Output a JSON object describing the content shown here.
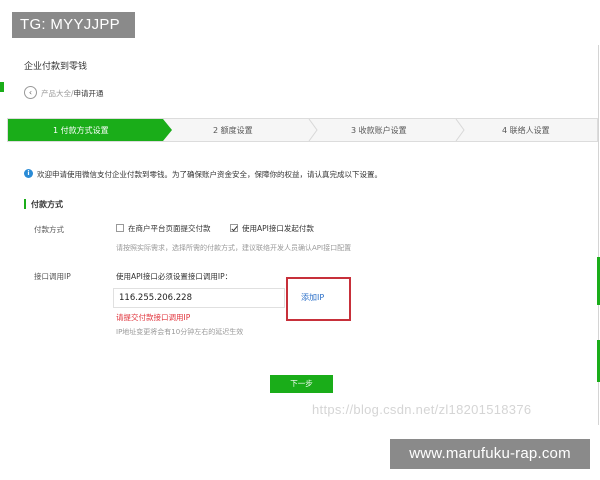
{
  "overlay": {
    "tg_badge": "TG: MYYJJPP",
    "footer_banner": "www.marufuku-rap.com",
    "watermark": "https://blog.csdn.net/zl18201518376"
  },
  "colors": {
    "accent_green": "#1aad19",
    "link_blue": "#2a6fc8",
    "error_red": "#e0323a",
    "highlight_box": "#c7303a"
  },
  "page": {
    "title": "企业付款到零钱"
  },
  "breadcrumb": {
    "icon": "back-arrow-icon",
    "parent": "产品大全",
    "separator": "/",
    "current": "申请开通"
  },
  "steps": [
    {
      "label": "1 付款方式设置",
      "active": true
    },
    {
      "label": "2 额度设置",
      "active": false
    },
    {
      "label": "3 收款账户设置",
      "active": false
    },
    {
      "label": "4 联络人设置",
      "active": false
    }
  ],
  "notice": {
    "icon": "info-icon",
    "text": "欢迎申请使用微信支付企业付款到零钱。为了确保账户资金安全，保障你的权益，请认真完成以下设置。"
  },
  "section": {
    "title": "付款方式"
  },
  "payment_method": {
    "label": "付款方式",
    "options": [
      {
        "label": "在商户平台页面提交付款",
        "checked": false
      },
      {
        "label": "使用API接口发起付款",
        "checked": true
      }
    ],
    "hint": "请按照实际需求，选择所需的付款方式，建议联络开发人员确认API接口配置"
  },
  "api_ip": {
    "label": "接口调用IP",
    "requirement": "使用API接口必须设置接口调用IP：",
    "value": "116.255.206.228",
    "add_link": "添加IP",
    "error": "请提交付款接口调用IP",
    "hint": "IP地址变更将会有10分钟左右的延迟生效"
  },
  "actions": {
    "next": "下一步"
  }
}
